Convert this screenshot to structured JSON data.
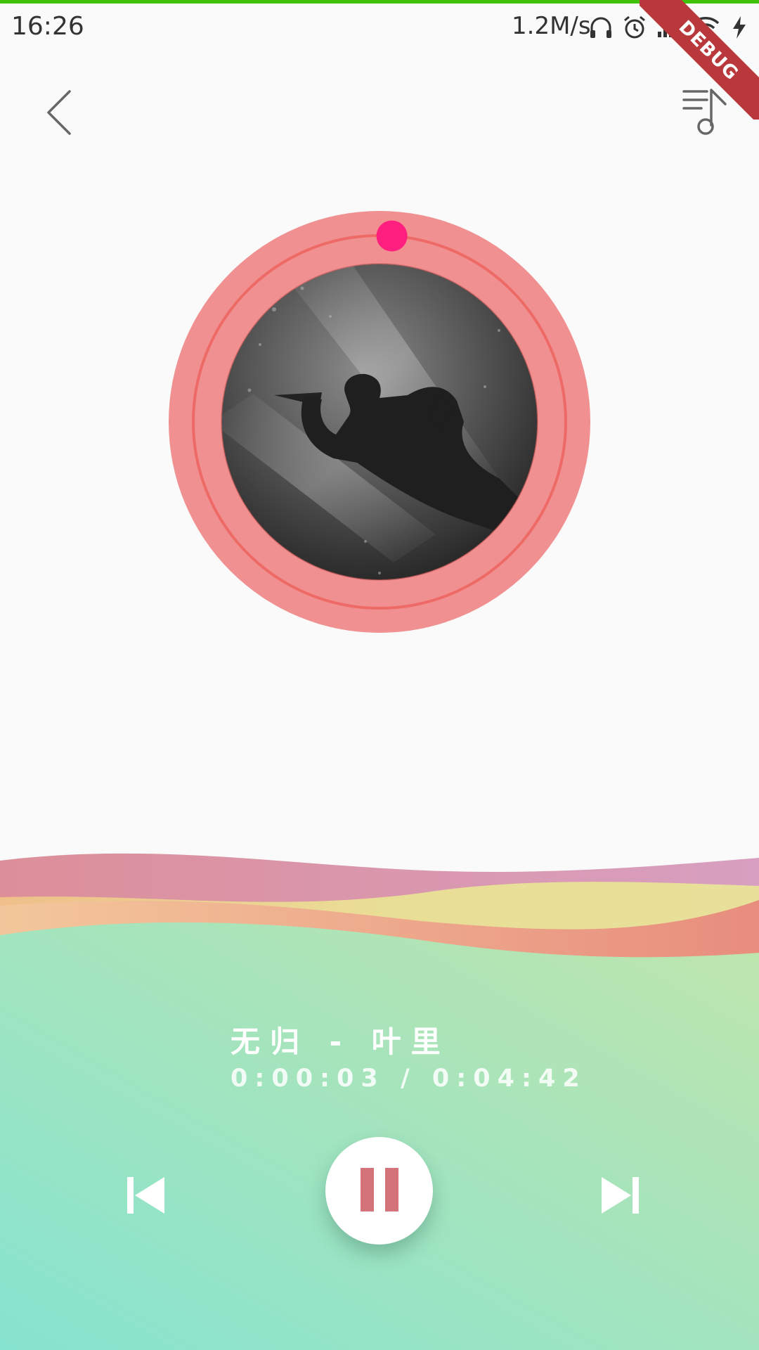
{
  "status_bar": {
    "time": "16:26",
    "net_speed": "1.2M/s",
    "icons": [
      "headphones-icon",
      "alarm-icon",
      "signal-icon",
      "wifi-icon",
      "charging-icon"
    ]
  },
  "debug_banner": "DEBUG",
  "header": {
    "back_icon": "chevron-left-icon",
    "playlist_icon": "playlist-music-icon"
  },
  "player": {
    "song_title": "无归 - 叶里",
    "time_display": "0:00:03 / 0:04:42",
    "progress_fraction": 0.0106,
    "controls": {
      "previous_icon": "skip-previous-icon",
      "pause_icon": "pause-icon",
      "next_icon": "skip-next-icon"
    }
  },
  "colors": {
    "disc_ring": "#f09090",
    "progress_ring": "#ee6a66",
    "progress_thumb": "#fe1f7e",
    "pause_color": "#d4737a",
    "wave_top": "#db8fa3",
    "wave_mid": "#eed890",
    "bottom_gradient_start": "#86e3cf",
    "bottom_gradient_end": "#bfe5ad"
  }
}
